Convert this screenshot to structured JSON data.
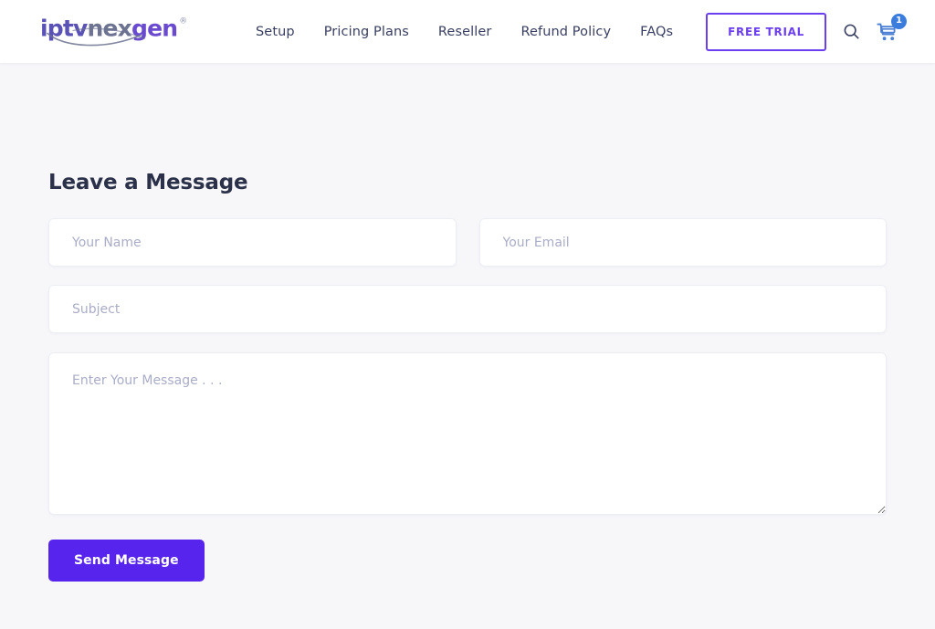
{
  "header": {
    "brand": {
      "segment_1": "iptv",
      "segment_2": "nex",
      "segment_3": "gen",
      "registered_mark": "®",
      "color_segment_1": "#5b52b5",
      "color_segment_2": "#6d7391",
      "color_segment_3": "#6a4bd0"
    },
    "nav_items": [
      {
        "label": "Setup"
      },
      {
        "label": "Pricing Plans"
      },
      {
        "label": "Reseller"
      },
      {
        "label": "Refund Policy"
      },
      {
        "label": "FAQs"
      }
    ],
    "free_trial_label": "FREE TRIAL",
    "search_icon": "search-icon",
    "cart_icon": "shopping-cart-icon",
    "cart_count": "1",
    "accent_color": "#6b3ff0",
    "cart_badge_color": "#3b7ddd"
  },
  "main": {
    "title": "Leave a Message",
    "fields": {
      "name_placeholder": "Your Name",
      "name_value": "",
      "email_placeholder": "Your Email",
      "email_value": "",
      "subject_placeholder": "Subject",
      "subject_value": "",
      "message_placeholder": "Enter Your Message . . .",
      "message_value": ""
    },
    "submit_label": "Send Message",
    "submit_color": "#5724ee"
  }
}
